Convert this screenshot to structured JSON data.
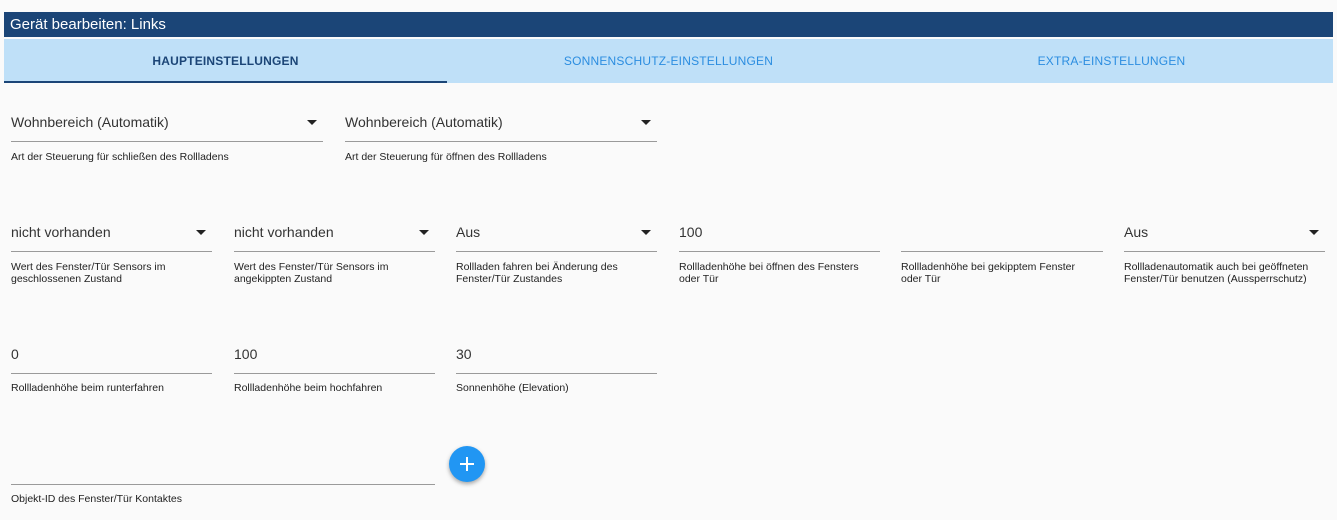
{
  "window": {
    "title": "Gerät bearbeiten: Links"
  },
  "tabs": [
    {
      "label": "HAUPTEINSTELLUNGEN",
      "active": true
    },
    {
      "label": "SONNENSCHUTZ-EINSTELLUNGEN",
      "active": false
    },
    {
      "label": "EXTRA-EINSTELLUNGEN",
      "active": false
    }
  ],
  "row1": [
    {
      "value": "Wohnbereich (Automatik)",
      "label": "Art der Steuerung für schließen des Rollladens",
      "type": "select"
    },
    {
      "value": "Wohnbereich (Automatik)",
      "label": "Art der Steuerung für öffnen des Rollladens",
      "type": "select"
    }
  ],
  "row2": [
    {
      "value": "nicht vorhanden",
      "label": "Wert des Fenster/Tür Sensors im geschlossenen Zustand",
      "type": "select"
    },
    {
      "value": "nicht vorhanden",
      "label": "Wert des Fenster/Tür Sensors im angekippten Zustand",
      "type": "select"
    },
    {
      "value": "Aus",
      "label": "Rollladen fahren bei Änderung des Fenster/Tür Zustandes",
      "type": "select"
    },
    {
      "value": "100",
      "label": "Rollladenhöhe bei öffnen des Fensters oder Tür",
      "type": "input"
    },
    {
      "value": "",
      "label": "Rollladenhöhe bei gekipptem Fenster oder Tür",
      "type": "input"
    },
    {
      "value": "Aus",
      "label": "Rollladenautomatik auch bei geöffneten Fenster/Tür benutzen (Aussperrschutz)",
      "type": "select"
    }
  ],
  "row3": [
    {
      "value": "0",
      "label": "Rollladenhöhe beim runterfahren",
      "type": "input"
    },
    {
      "value": "100",
      "label": "Rollladenhöhe beim hochfahren",
      "type": "input"
    },
    {
      "value": "30",
      "label": "Sonnenhöhe (Elevation)",
      "type": "input"
    }
  ],
  "contact": {
    "value": "",
    "label": "Objekt-ID des Fenster/Tür Kontaktes"
  },
  "add_button": {
    "icon": "plus-icon",
    "color": "#2196f3"
  },
  "colors": {
    "titlebar": "#1b4577",
    "tabbar": "#bfe0f8",
    "tab_active": "#1b4577",
    "tab_inactive": "#2b8de0"
  }
}
